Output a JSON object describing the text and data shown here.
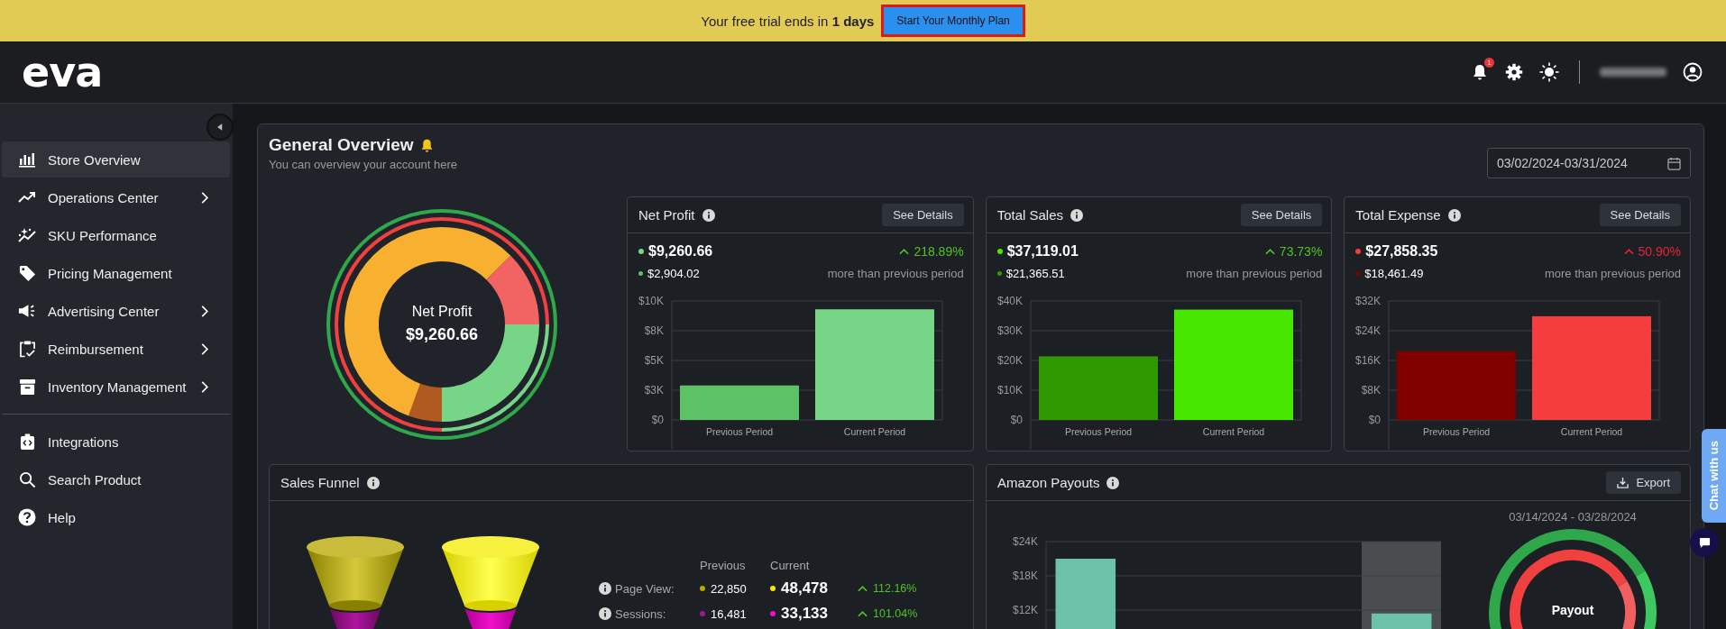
{
  "banner": {
    "message": "Your free trial ends in **1 days**",
    "button": "Start Your Monthly Plan"
  },
  "header": {
    "logo": "eva",
    "notification_count": "1"
  },
  "sidebar": {
    "sections": [
      {
        "items": [
          {
            "label": "Store Overview",
            "selected": true,
            "expandable": false
          },
          {
            "label": "Operations Center",
            "selected": false,
            "expandable": true
          },
          {
            "label": "SKU Performance",
            "selected": false,
            "expandable": false
          },
          {
            "label": "Pricing Management",
            "selected": false,
            "expandable": false
          },
          {
            "label": "Advertising Center",
            "selected": false,
            "expandable": true
          },
          {
            "label": "Reimbursement",
            "selected": false,
            "expandable": true
          },
          {
            "label": "Inventory Management",
            "selected": false,
            "expandable": true
          }
        ]
      },
      {
        "items": [
          {
            "label": "Integrations",
            "selected": false,
            "expandable": false
          },
          {
            "label": "Search Product",
            "selected": false,
            "expandable": false
          },
          {
            "label": "Help",
            "selected": false,
            "expandable": false
          }
        ]
      }
    ]
  },
  "overview": {
    "title": "General Overview",
    "subtitle": "You can overview your account here",
    "date_range": "03/02/2024-03/31/2024",
    "ring_label": "Net Profit",
    "ring_value": "$9,260.66"
  },
  "metric_cards": [
    {
      "title": "Net Profit",
      "button": "See Details",
      "current_value": "$9,260.66",
      "previous_value": "$2,904.02",
      "change": "218.89%",
      "favorable": true,
      "comparison": "more than previous period",
      "chart_data": {
        "type": "bar",
        "grid": true,
        "series": [
          {
            "name": "Previous Period",
            "color": "#5cc265",
            "values": [
              2900,
              null
            ]
          },
          {
            "name": "Current Period",
            "color": "#77d587",
            "values": [
              null,
              9300
            ]
          }
        ],
        "ylim": [
          0,
          10000
        ],
        "yticks": [
          {
            "value": 0,
            "label": "$0"
          },
          {
            "value": 2500,
            "label": "$3K"
          },
          {
            "value": 5000,
            "label": "$5K"
          },
          {
            "value": 7500,
            "label": "$8K"
          },
          {
            "value": 10000,
            "label": "$10K"
          }
        ]
      }
    },
    {
      "title": "Total Sales",
      "button": "See Details",
      "current_value": "$37,119.01",
      "previous_value": "$21,365.51",
      "change": "73.73%",
      "favorable": true,
      "comparison": "more than previous period",
      "chart_data": {
        "type": "bar",
        "grid": true,
        "series": [
          {
            "name": "Previous Period",
            "color": "#2e9a00",
            "values": [
              21400,
              null
            ]
          },
          {
            "name": "Current Period",
            "color": "#46e800",
            "values": [
              null,
              37100
            ]
          }
        ],
        "ylim": [
          0,
          40000
        ],
        "yticks": [
          {
            "value": 0,
            "label": "$0"
          },
          {
            "value": 10000,
            "label": "$10K"
          },
          {
            "value": 20000,
            "label": "$20K"
          },
          {
            "value": 30000,
            "label": "$30K"
          },
          {
            "value": 40000,
            "label": "$40K"
          }
        ]
      }
    },
    {
      "title": "Total Expense",
      "button": "See Details",
      "current_value": "$27,858.35",
      "previous_value": "$18,461.49",
      "change": "50.90%",
      "favorable": false,
      "comparison": "more than previous period",
      "chart_data": {
        "type": "bar",
        "grid": true,
        "series": [
          {
            "name": "Previous Period",
            "color": "#800000",
            "values": [
              18500,
              null
            ]
          },
          {
            "name": "Current Period",
            "color": "#f53d3d",
            "values": [
              null,
              27900
            ]
          }
        ],
        "ylim": [
          0,
          32000
        ],
        "yticks": [
          {
            "value": 0,
            "label": "$0"
          },
          {
            "value": 8000,
            "label": "$8K"
          },
          {
            "value": 16000,
            "label": "$16K"
          },
          {
            "value": 24000,
            "label": "$24K"
          },
          {
            "value": 32000,
            "label": "$32K"
          }
        ]
      }
    }
  ],
  "sales_funnel": {
    "title": "Sales Funnel",
    "columns": [
      "Previous",
      "Current"
    ],
    "rows": [
      {
        "label": "Page View:",
        "previous": {
          "value": "22,850",
          "color": "#b5a800"
        },
        "current": {
          "value": "48,478",
          "color": "#f5e800"
        },
        "change": "112.16%"
      },
      {
        "label": "Sessions:",
        "previous": {
          "value": "16,481",
          "color": "#9c1a8f"
        },
        "current": {
          "value": "33,133",
          "color": "#f010c8"
        },
        "change": "101.04%"
      }
    ]
  },
  "amazon_payouts": {
    "title": "Amazon Payouts",
    "button": "Export",
    "date_range": "03/14/2024 - 03/28/2024",
    "donut_label": "Payout",
    "chart_data": {
      "type": "bar",
      "grid": true,
      "series": [
        {
          "color": "#6cc2a8",
          "values": [
            21000,
            null,
            null,
            null,
            11400
          ]
        }
      ],
      "ylim": [
        0,
        24000
      ],
      "yticks": [
        {
          "value": 12000,
          "label": "$12K"
        },
        {
          "value": 18000,
          "label": "$18K"
        },
        {
          "value": 24000,
          "label": "$24K"
        }
      ]
    }
  },
  "chat_tab": {
    "label": "Chat with us"
  }
}
